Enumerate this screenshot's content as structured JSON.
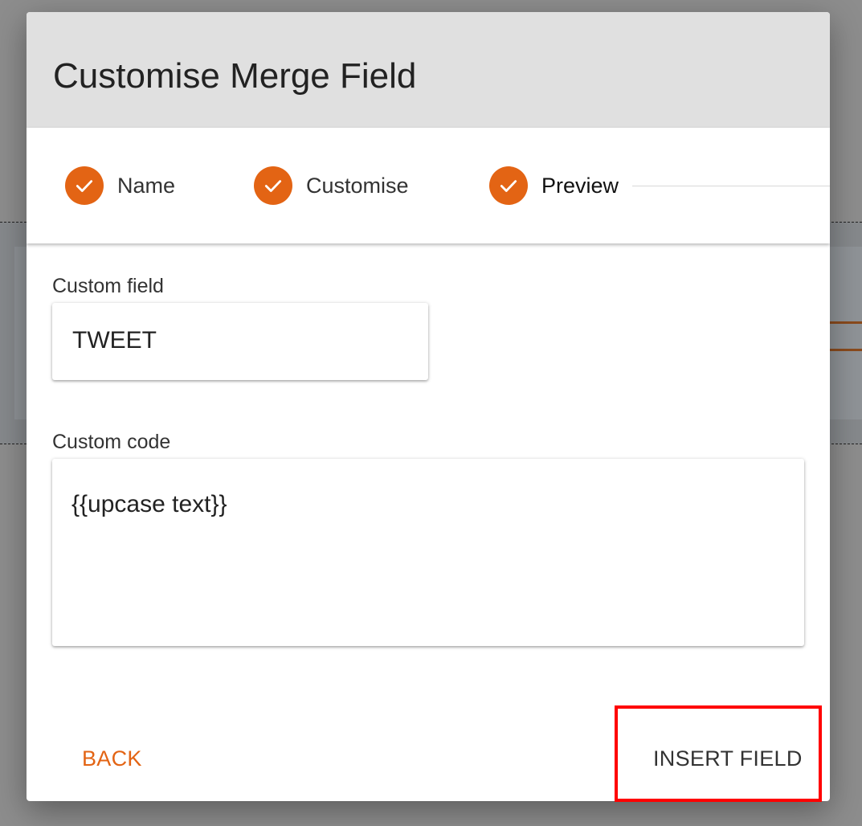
{
  "dialog": {
    "title": "Customise Merge Field"
  },
  "stepper": {
    "steps": [
      {
        "label": "Name",
        "icon": "check-icon",
        "completed": true
      },
      {
        "label": "Customise",
        "icon": "check-icon",
        "completed": true
      },
      {
        "label": "Preview",
        "icon": "check-icon",
        "completed": true,
        "active": true
      }
    ]
  },
  "form": {
    "custom_field": {
      "label": "Custom field",
      "value": "TWEET"
    },
    "custom_code": {
      "label": "Custom code",
      "value": "{{upcase text}}"
    }
  },
  "actions": {
    "back_label": "BACK",
    "insert_label": "INSERT FIELD"
  },
  "colors": {
    "accent": "#e36414",
    "header_bg": "#e0e0e0",
    "highlight": "#ff0000"
  }
}
